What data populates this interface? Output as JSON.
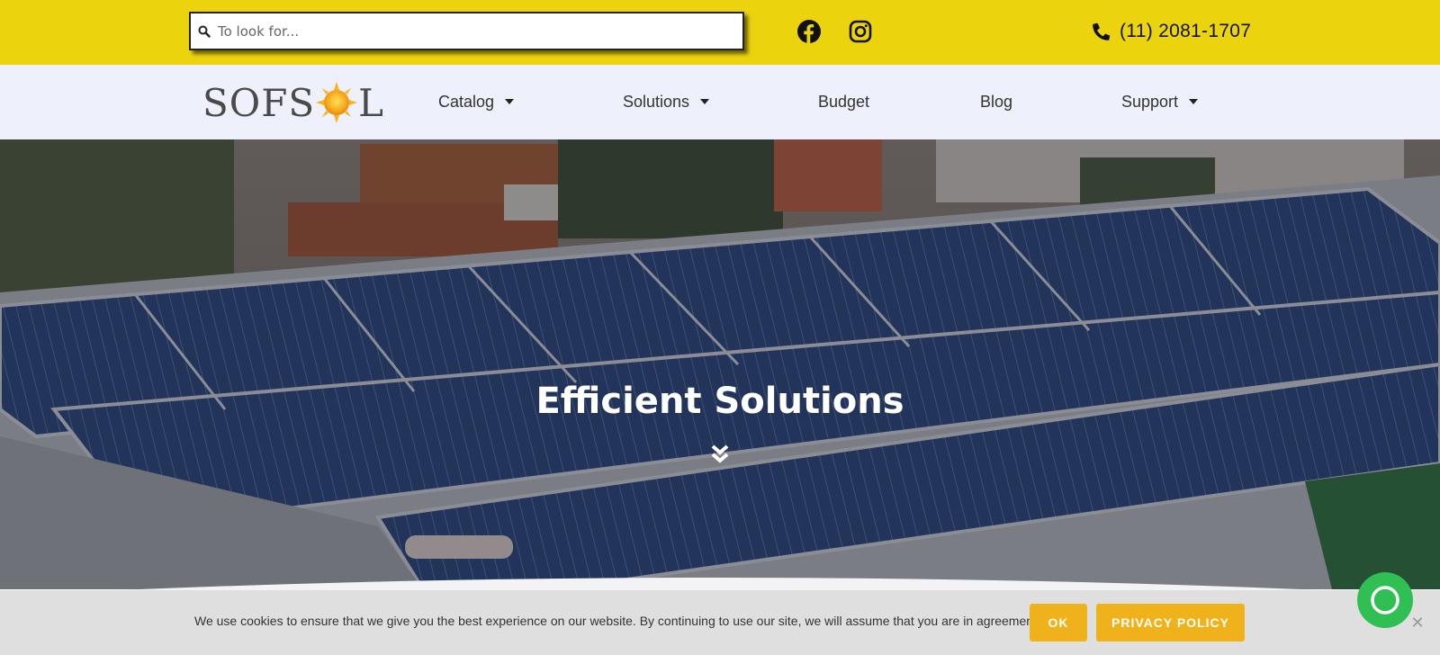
{
  "search": {
    "placeholder": "To look for..."
  },
  "social": {
    "facebook_icon": "facebook-icon",
    "instagram_icon": "instagram-icon"
  },
  "contact": {
    "phone": "(11) 2081-1707",
    "icon": "phone-icon"
  },
  "logo": {
    "part1": "SOFS",
    "part2": "L",
    "icon": "sun-icon"
  },
  "nav": {
    "items": [
      {
        "label": "Catalog",
        "dropdown": true
      },
      {
        "label": "Solutions",
        "dropdown": true
      },
      {
        "label": "Budget",
        "dropdown": false
      },
      {
        "label": "Blog",
        "dropdown": false
      },
      {
        "label": "Support",
        "dropdown": true
      }
    ]
  },
  "hero": {
    "title": "Efficient Solutions",
    "scroll_icon": "double-chevron-down-icon"
  },
  "cookie": {
    "message": "We use cookies to ensure that we give you the best experience on our website. By continuing to use our site, we will assume that you are in agreement.",
    "ok_label": "OK",
    "privacy_label": "PRIVACY POLICY",
    "close_glyph": "✕"
  },
  "colors": {
    "topbar": "#ebd40e",
    "navbar": "#eef1fb",
    "button": "#f0b21a",
    "cookie_bg": "#dfdfdf",
    "whatsapp": "#2fbf53"
  }
}
